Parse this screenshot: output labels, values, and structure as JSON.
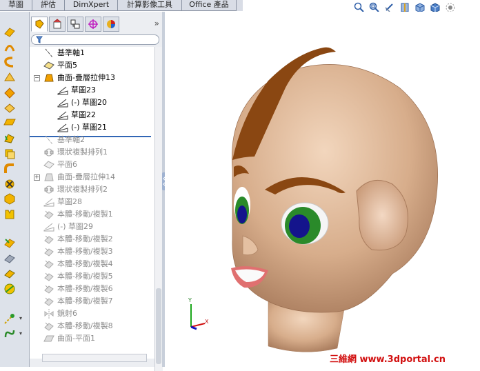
{
  "command_manager": {
    "tabs": [
      "草圖",
      "評估",
      "DimXpert",
      "計算影像工具",
      "Office 產品"
    ]
  },
  "feature_tree": {
    "items": [
      {
        "label": "基準軸1",
        "dim": false
      },
      {
        "label": "平面5",
        "dim": false
      },
      {
        "label": "曲面-疊層拉伸13",
        "dim": false
      },
      {
        "label": "草圖23",
        "dim": false
      },
      {
        "label": "(-) 草圖20",
        "dim": false
      },
      {
        "label": "草圖22",
        "dim": false
      },
      {
        "label": "(-) 草圖21",
        "dim": false
      },
      {
        "label": "基準軸2",
        "dim": true
      },
      {
        "label": "環狀複製排列1",
        "dim": true
      },
      {
        "label": "平面6",
        "dim": true
      },
      {
        "label": "曲面-疊層拉伸14",
        "dim": true
      },
      {
        "label": "環狀複製排列2",
        "dim": true
      },
      {
        "label": "草圖28",
        "dim": true
      },
      {
        "label": "本體-移動/複製1",
        "dim": true
      },
      {
        "label": "(-) 草圖29",
        "dim": true
      },
      {
        "label": "本體-移動/複製2",
        "dim": true
      },
      {
        "label": "本體-移動/複製3",
        "dim": true
      },
      {
        "label": "本體-移動/複製4",
        "dim": true
      },
      {
        "label": "本體-移動/複製5",
        "dim": true
      },
      {
        "label": "本體-移動/複製6",
        "dim": true
      },
      {
        "label": "本體-移動/複製7",
        "dim": true
      },
      {
        "label": "鏡射6",
        "dim": true
      },
      {
        "label": "本體-移動/複製8",
        "dim": true
      },
      {
        "label": "曲面-平面1",
        "dim": true
      }
    ]
  },
  "triad": {
    "x": "X",
    "y": "Y"
  },
  "watermark": "三維網 www.3dportal.cn",
  "colors": {
    "skin": "#d9b392",
    "hair": "#8a4712",
    "eye_iris": "#2a8a2a",
    "pupil": "#14148c",
    "rollback": "#3166b5"
  }
}
